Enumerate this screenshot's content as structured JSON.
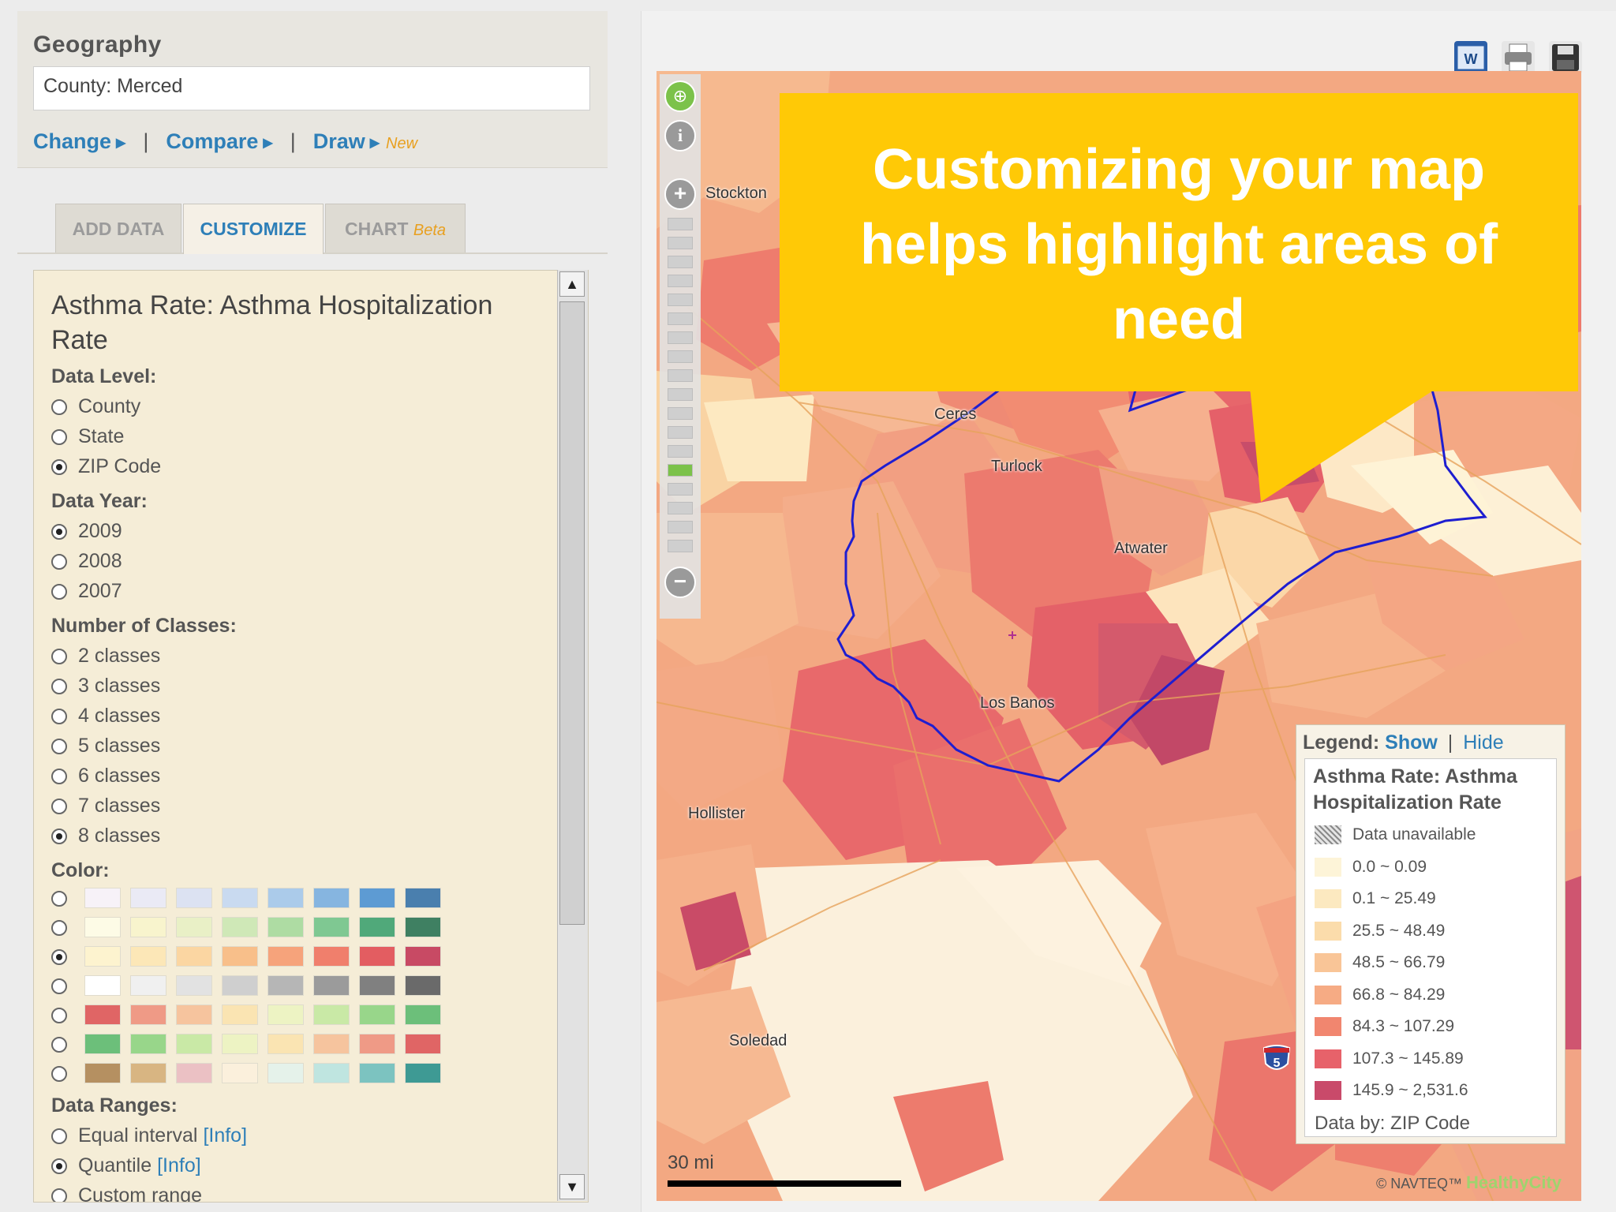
{
  "geography": {
    "title": "Geography",
    "value": "County: Merced",
    "change": "Change",
    "compare": "Compare",
    "draw": "Draw",
    "new_badge": "New",
    "sep": "|"
  },
  "tabs": [
    {
      "label": "ADD DATA",
      "active": false
    },
    {
      "label": "CUSTOMIZE",
      "active": true
    },
    {
      "label": "CHART",
      "badge": "Beta",
      "active": false
    }
  ],
  "customize": {
    "title": "Asthma Rate: Asthma Hospitalization Rate",
    "data_level": {
      "label": "Data Level:",
      "options": [
        "County",
        "State",
        "ZIP Code"
      ],
      "selected": "ZIP Code"
    },
    "data_year": {
      "label": "Data Year:",
      "options": [
        "2009",
        "2008",
        "2007"
      ],
      "selected": "2009"
    },
    "classes": {
      "label": "Number of Classes:",
      "options": [
        "2 classes",
        "3 classes",
        "4 classes",
        "5 classes",
        "6 classes",
        "7 classes",
        "8 classes"
      ],
      "selected": "8 classes"
    },
    "color": {
      "label": "Color:",
      "selected_row": 2,
      "palettes": [
        [
          "#f7f2f8",
          "#eaeaf5",
          "#dce2f2",
          "#c9daf0",
          "#abcbea",
          "#86b5e0",
          "#5d9bd3",
          "#4a7fae"
        ],
        [
          "#fdfbe6",
          "#f8f4cd",
          "#e9f0c6",
          "#cfe8b7",
          "#aedca3",
          "#7fc892",
          "#50a97a",
          "#3f8062"
        ],
        [
          "#fdf3cf",
          "#fce7b7",
          "#fbd6a2",
          "#f8bf8a",
          "#f6a37b",
          "#f07f6c",
          "#e35d61",
          "#c84a64"
        ],
        [
          "#ffffff",
          "#f0f0f0",
          "#e2e2e2",
          "#cfcfcf",
          "#b6b6b6",
          "#9b9b9b",
          "#808080",
          "#6a6a6a"
        ],
        [
          "#e06565",
          "#ef9a86",
          "#f6c49e",
          "#fae4b2",
          "#edf3c3",
          "#c9e9a6",
          "#98d68a",
          "#6cbf7a"
        ],
        [
          "#6cbf7a",
          "#98d68a",
          "#c9e9a6",
          "#edf3c3",
          "#fae4b2",
          "#f6c49e",
          "#ef9a86",
          "#e06565"
        ],
        [
          "#b59061",
          "#d8b582",
          "#ebc1c4",
          "#fbf0dc",
          "#e5f2ea",
          "#bfe5e0",
          "#7cc3c0",
          "#3e9a94"
        ]
      ]
    },
    "data_ranges": {
      "label": "Data Ranges:",
      "options": [
        {
          "text": "Equal interval",
          "info": "[Info]"
        },
        {
          "text": "Quantile",
          "info": "[Info]"
        },
        {
          "text": "Custom range",
          "info": ""
        }
      ],
      "selected": "Quantile"
    }
  },
  "callout": {
    "lines": [
      "Customizing your map",
      "helps highlight areas of",
      "need"
    ],
    "color": "#ffc906"
  },
  "map": {
    "places": [
      "Stockton",
      "Ceres",
      "Turlock",
      "Atwater",
      "Los Banos",
      "Hollister",
      "Soledad"
    ],
    "scale_label": "30 mi",
    "copyright": "© NAVTEQ™",
    "brand": "HealthyCity",
    "highway": "5",
    "toolbar_icons": [
      "word-export-icon",
      "print-icon",
      "save-icon"
    ],
    "nav_icons": [
      "globe-icon",
      "info-icon",
      "zoom-in-icon",
      "zoom-out-icon"
    ],
    "zoom_level": 13,
    "zoom_steps": 18
  },
  "legend": {
    "label": "Legend:",
    "show": "Show",
    "sep": "|",
    "hide": "Hide",
    "title": "Asthma Rate: Asthma Hospitalization Rate",
    "items": [
      {
        "label": "Data unavailable",
        "color": "hatch"
      },
      {
        "label": "0.0 ~ 0.09",
        "color": "#fdf4d8"
      },
      {
        "label": "0.1 ~ 25.49",
        "color": "#fce9c0"
      },
      {
        "label": "25.5 ~ 48.49",
        "color": "#fbdcab"
      },
      {
        "label": "48.5 ~ 66.79",
        "color": "#f9c597"
      },
      {
        "label": "66.8 ~ 84.29",
        "color": "#f6ab84"
      },
      {
        "label": "84.3 ~ 107.29",
        "color": "#f1866f"
      },
      {
        "label": "107.3 ~ 145.89",
        "color": "#e7626a"
      },
      {
        "label": "145.9 ~ 2,531.6",
        "color": "#c94a6a"
      }
    ],
    "footer": "Data by: ZIP Code"
  }
}
